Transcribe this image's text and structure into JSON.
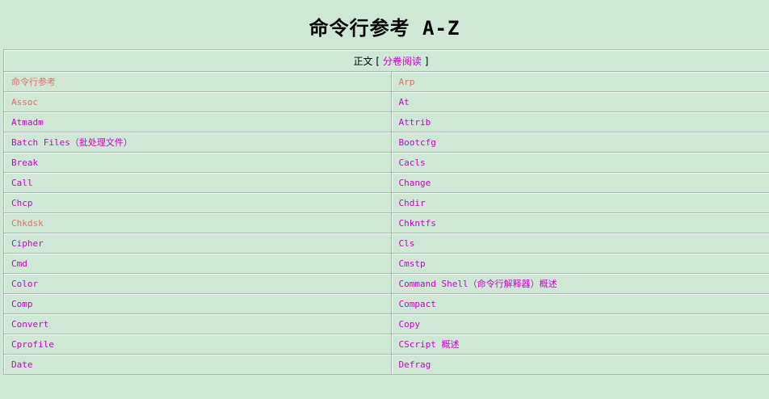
{
  "page": {
    "title": "命令行参考 A-Z"
  },
  "nav": {
    "main_text": "正文",
    "open_bracket": "[",
    "volume_link": "分卷阅读",
    "close_bracket": "]"
  },
  "colors": {
    "background": "#cfe8d6",
    "link": "#cc00cc",
    "visited_link": "#e0706a",
    "border": "#a9b9ad"
  },
  "rows": [
    {
      "left": {
        "label": "命令行参考",
        "visited": true
      },
      "right": {
        "label": "Arp",
        "visited": true
      }
    },
    {
      "left": {
        "label": "Assoc",
        "visited": true
      },
      "right": {
        "label": "At",
        "visited": false
      }
    },
    {
      "left": {
        "label": "Atmadm",
        "visited": false
      },
      "right": {
        "label": "Attrib",
        "visited": false
      }
    },
    {
      "left": {
        "label": "Batch Files（批处理文件）",
        "visited": false
      },
      "right": {
        "label": "Bootcfg",
        "visited": false
      }
    },
    {
      "left": {
        "label": "Break",
        "visited": false
      },
      "right": {
        "label": "Cacls",
        "visited": false
      }
    },
    {
      "left": {
        "label": "Call",
        "visited": false
      },
      "right": {
        "label": "Change",
        "visited": false
      }
    },
    {
      "left": {
        "label": "Chcp",
        "visited": false
      },
      "right": {
        "label": "Chdir",
        "visited": false
      }
    },
    {
      "left": {
        "label": "Chkdsk",
        "visited": true
      },
      "right": {
        "label": "Chkntfs",
        "visited": false
      }
    },
    {
      "left": {
        "label": "Cipher",
        "visited": false
      },
      "right": {
        "label": "Cls",
        "visited": false
      }
    },
    {
      "left": {
        "label": "Cmd",
        "visited": false
      },
      "right": {
        "label": "Cmstp",
        "visited": false
      }
    },
    {
      "left": {
        "label": "Color",
        "visited": false
      },
      "right": {
        "label": "Command Shell（命令行解释器）概述",
        "visited": false
      }
    },
    {
      "left": {
        "label": "Comp",
        "visited": false
      },
      "right": {
        "label": "Compact",
        "visited": false
      }
    },
    {
      "left": {
        "label": "Convert",
        "visited": false
      },
      "right": {
        "label": "Copy",
        "visited": false
      }
    },
    {
      "left": {
        "label": "Cprofile",
        "visited": false
      },
      "right": {
        "label": "CScript 概述",
        "visited": false
      }
    },
    {
      "left": {
        "label": "Date",
        "visited": false
      },
      "right": {
        "label": "Defrag",
        "visited": false
      }
    }
  ]
}
